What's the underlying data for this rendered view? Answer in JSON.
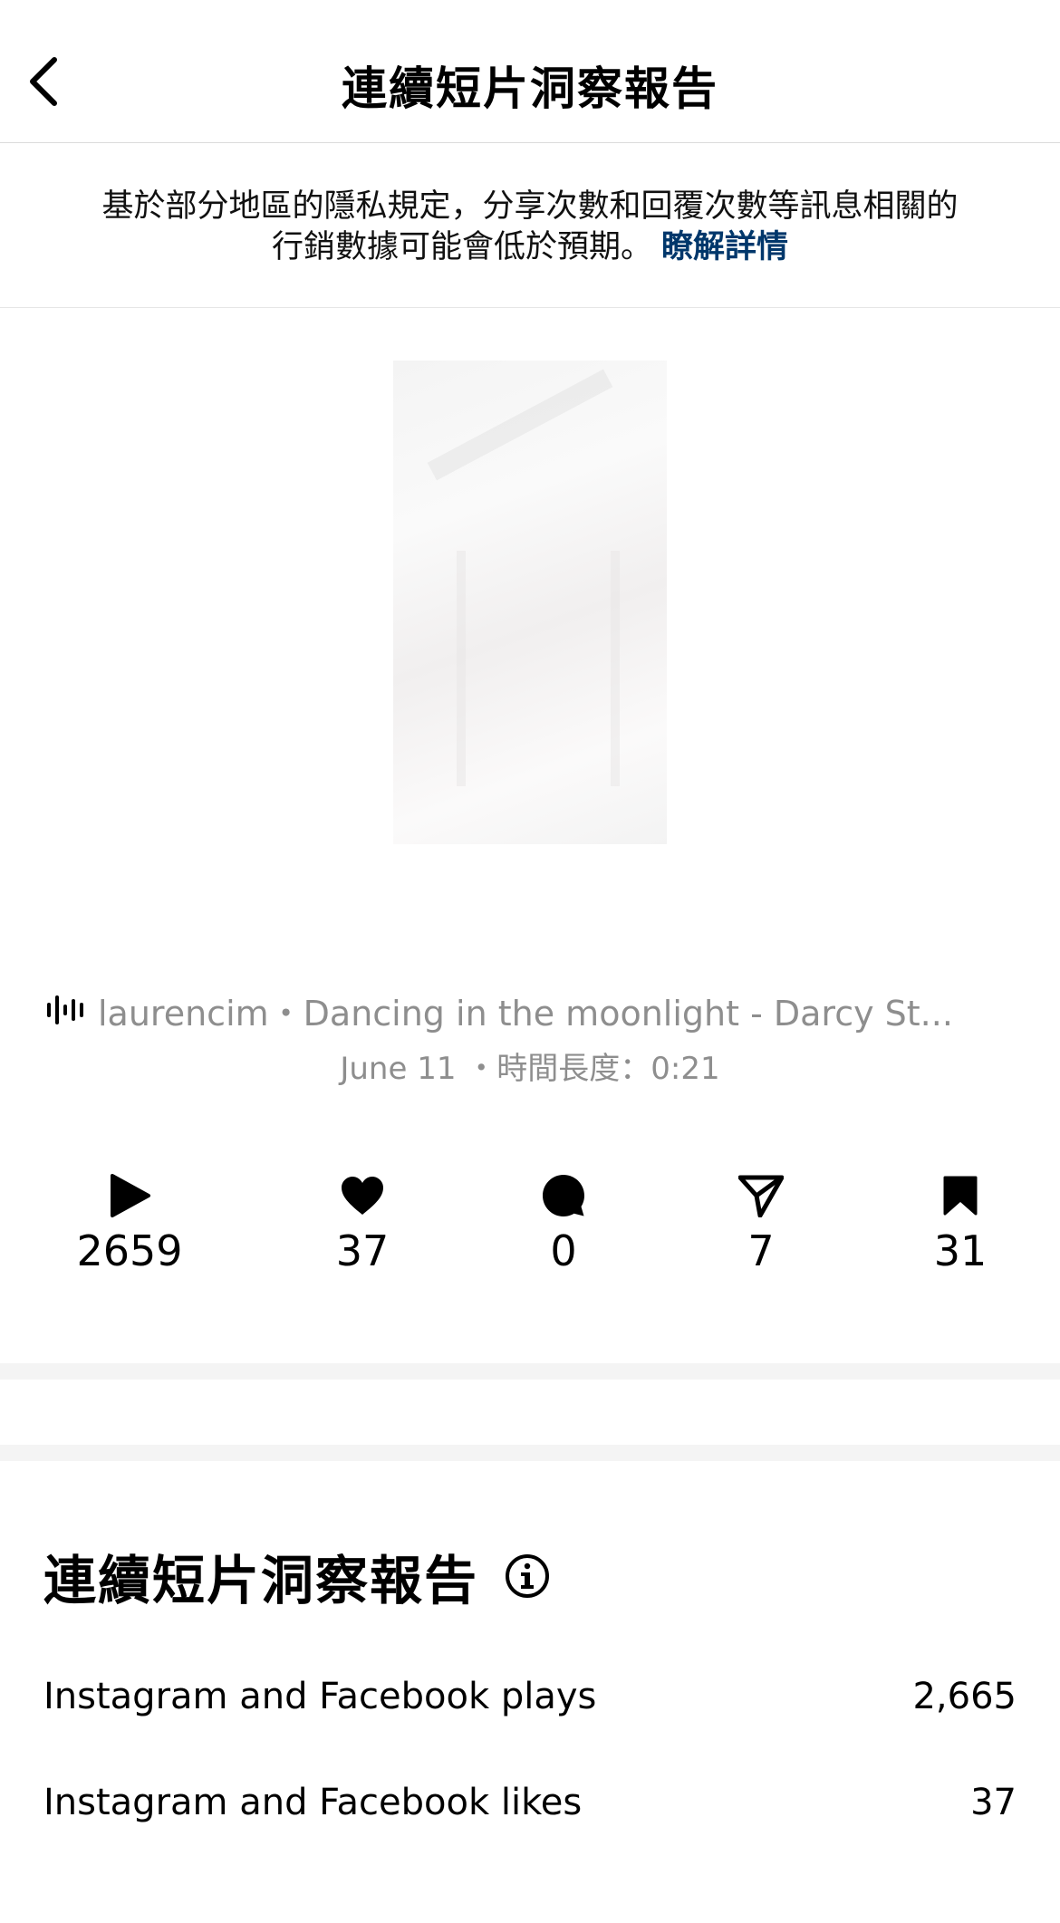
{
  "header": {
    "title": "連續短片洞察報告"
  },
  "notice": {
    "text": "基於部分地區的隱私規定，分享次數和回覆次數等訊息相關的行銷數據可能會低於預期。",
    "link_label": "瞭解詳情"
  },
  "reel": {
    "audio_label": "laurencim・Dancing in the moonlight - Darcy St...",
    "date": "June 11",
    "duration_label": "時間長度：0:21"
  },
  "stats": {
    "plays": "2659",
    "likes": "37",
    "comments": "0",
    "shares": "7",
    "saves": "31"
  },
  "insights": {
    "title": "連續短片洞察報告",
    "rows": [
      {
        "label": "Instagram and Facebook plays",
        "value": "2,665"
      },
      {
        "label": "Instagram and Facebook likes",
        "value": "37"
      }
    ]
  },
  "colors": {
    "link": "#00376b",
    "muted_text": "#8e8e8e",
    "divider": "#f4f4f4"
  },
  "icons": [
    "chevron-left-icon",
    "audio-wave-icon",
    "play-icon",
    "heart-icon",
    "comment-icon",
    "share-icon",
    "bookmark-icon",
    "info-icon"
  ]
}
